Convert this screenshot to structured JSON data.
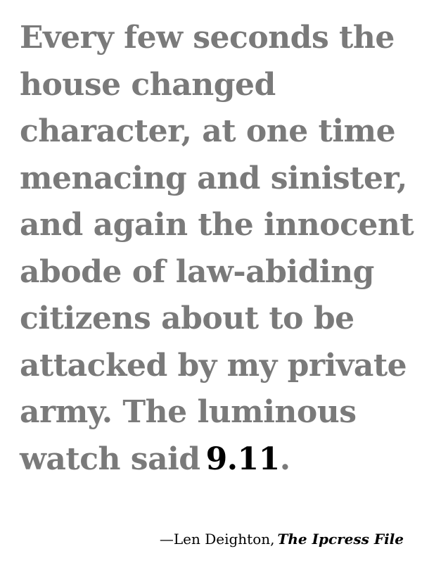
{
  "quote": {
    "lines": [
      "Every few seconds the",
      "house changed",
      "character, at one time",
      "menacing and sinister,",
      "and again the innocent",
      "abode of law-abiding",
      "citizens about to be",
      "attacked by my private",
      "army. The luminous",
      "watch said"
    ],
    "time": "9.11",
    "end_punct": "."
  },
  "attribution": {
    "author": "—Len Deighton,",
    "book": "The Ipcress File"
  },
  "colors": {
    "text_gray": "#7a7a7a",
    "highlight": "#000000",
    "background": "#ffffff"
  }
}
